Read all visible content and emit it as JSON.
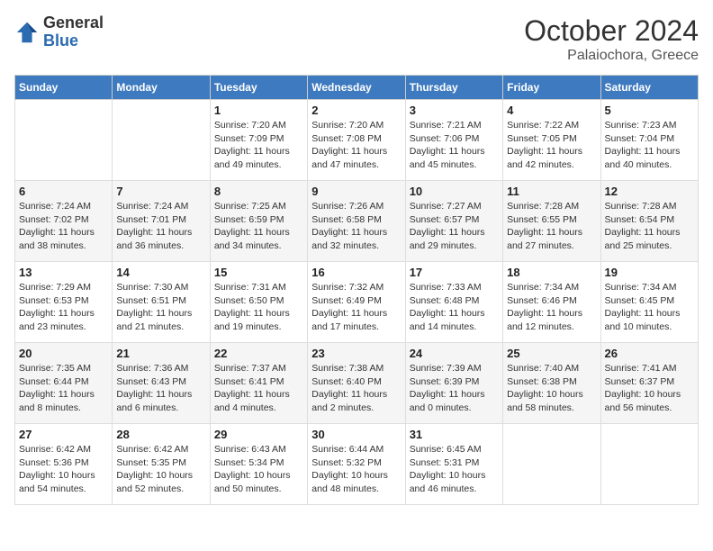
{
  "header": {
    "logo": {
      "general": "General",
      "blue": "Blue"
    },
    "title": "October 2024",
    "location": "Palaiochora, Greece"
  },
  "weekdays": [
    "Sunday",
    "Monday",
    "Tuesday",
    "Wednesday",
    "Thursday",
    "Friday",
    "Saturday"
  ],
  "weeks": [
    [
      null,
      null,
      {
        "day": 1,
        "sunrise": "7:20 AM",
        "sunset": "7:09 PM",
        "daylight": "11 hours and 49 minutes."
      },
      {
        "day": 2,
        "sunrise": "7:20 AM",
        "sunset": "7:08 PM",
        "daylight": "11 hours and 47 minutes."
      },
      {
        "day": 3,
        "sunrise": "7:21 AM",
        "sunset": "7:06 PM",
        "daylight": "11 hours and 45 minutes."
      },
      {
        "day": 4,
        "sunrise": "7:22 AM",
        "sunset": "7:05 PM",
        "daylight": "11 hours and 42 minutes."
      },
      {
        "day": 5,
        "sunrise": "7:23 AM",
        "sunset": "7:04 PM",
        "daylight": "11 hours and 40 minutes."
      }
    ],
    [
      {
        "day": 6,
        "sunrise": "7:24 AM",
        "sunset": "7:02 PM",
        "daylight": "11 hours and 38 minutes."
      },
      {
        "day": 7,
        "sunrise": "7:24 AM",
        "sunset": "7:01 PM",
        "daylight": "11 hours and 36 minutes."
      },
      {
        "day": 8,
        "sunrise": "7:25 AM",
        "sunset": "6:59 PM",
        "daylight": "11 hours and 34 minutes."
      },
      {
        "day": 9,
        "sunrise": "7:26 AM",
        "sunset": "6:58 PM",
        "daylight": "11 hours and 32 minutes."
      },
      {
        "day": 10,
        "sunrise": "7:27 AM",
        "sunset": "6:57 PM",
        "daylight": "11 hours and 29 minutes."
      },
      {
        "day": 11,
        "sunrise": "7:28 AM",
        "sunset": "6:55 PM",
        "daylight": "11 hours and 27 minutes."
      },
      {
        "day": 12,
        "sunrise": "7:28 AM",
        "sunset": "6:54 PM",
        "daylight": "11 hours and 25 minutes."
      }
    ],
    [
      {
        "day": 13,
        "sunrise": "7:29 AM",
        "sunset": "6:53 PM",
        "daylight": "11 hours and 23 minutes."
      },
      {
        "day": 14,
        "sunrise": "7:30 AM",
        "sunset": "6:51 PM",
        "daylight": "11 hours and 21 minutes."
      },
      {
        "day": 15,
        "sunrise": "7:31 AM",
        "sunset": "6:50 PM",
        "daylight": "11 hours and 19 minutes."
      },
      {
        "day": 16,
        "sunrise": "7:32 AM",
        "sunset": "6:49 PM",
        "daylight": "11 hours and 17 minutes."
      },
      {
        "day": 17,
        "sunrise": "7:33 AM",
        "sunset": "6:48 PM",
        "daylight": "11 hours and 14 minutes."
      },
      {
        "day": 18,
        "sunrise": "7:34 AM",
        "sunset": "6:46 PM",
        "daylight": "11 hours and 12 minutes."
      },
      {
        "day": 19,
        "sunrise": "7:34 AM",
        "sunset": "6:45 PM",
        "daylight": "11 hours and 10 minutes."
      }
    ],
    [
      {
        "day": 20,
        "sunrise": "7:35 AM",
        "sunset": "6:44 PM",
        "daylight": "11 hours and 8 minutes."
      },
      {
        "day": 21,
        "sunrise": "7:36 AM",
        "sunset": "6:43 PM",
        "daylight": "11 hours and 6 minutes."
      },
      {
        "day": 22,
        "sunrise": "7:37 AM",
        "sunset": "6:41 PM",
        "daylight": "11 hours and 4 minutes."
      },
      {
        "day": 23,
        "sunrise": "7:38 AM",
        "sunset": "6:40 PM",
        "daylight": "11 hours and 2 minutes."
      },
      {
        "day": 24,
        "sunrise": "7:39 AM",
        "sunset": "6:39 PM",
        "daylight": "11 hours and 0 minutes."
      },
      {
        "day": 25,
        "sunrise": "7:40 AM",
        "sunset": "6:38 PM",
        "daylight": "10 hours and 58 minutes."
      },
      {
        "day": 26,
        "sunrise": "7:41 AM",
        "sunset": "6:37 PM",
        "daylight": "10 hours and 56 minutes."
      }
    ],
    [
      {
        "day": 27,
        "sunrise": "6:42 AM",
        "sunset": "5:36 PM",
        "daylight": "10 hours and 54 minutes."
      },
      {
        "day": 28,
        "sunrise": "6:42 AM",
        "sunset": "5:35 PM",
        "daylight": "10 hours and 52 minutes."
      },
      {
        "day": 29,
        "sunrise": "6:43 AM",
        "sunset": "5:34 PM",
        "daylight": "10 hours and 50 minutes."
      },
      {
        "day": 30,
        "sunrise": "6:44 AM",
        "sunset": "5:32 PM",
        "daylight": "10 hours and 48 minutes."
      },
      {
        "day": 31,
        "sunrise": "6:45 AM",
        "sunset": "5:31 PM",
        "daylight": "10 hours and 46 minutes."
      },
      null,
      null
    ]
  ]
}
